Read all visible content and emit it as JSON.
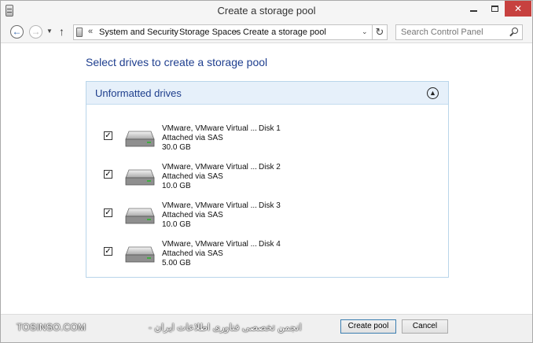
{
  "window": {
    "title": "Create a storage pool"
  },
  "title_buttons": {
    "minimize_icon": "minimize-icon",
    "maximize_icon": "maximize-icon",
    "close_label": "✕"
  },
  "nav": {
    "back_glyph": "←",
    "forward_glyph": "→",
    "up_glyph": "↑",
    "refresh_glyph": "↻",
    "breadcrumb": [
      "System and Security",
      "Storage Spaces",
      "Create a storage pool"
    ],
    "breadcrumb_prefix": "«",
    "search_placeholder": "Search Control Panel"
  },
  "main": {
    "heading": "Select drives to create a storage pool",
    "group_title": "Unformatted drives",
    "drives": [
      {
        "name": "VMware, VMware Virtual ...",
        "disk": "Disk 1",
        "attach": "Attached via SAS",
        "size": "30.0 GB",
        "checked": true
      },
      {
        "name": "VMware, VMware Virtual ...",
        "disk": "Disk 2",
        "attach": "Attached via SAS",
        "size": "10.0 GB",
        "checked": true
      },
      {
        "name": "VMware, VMware Virtual ...",
        "disk": "Disk 3",
        "attach": "Attached via SAS",
        "size": "10.0 GB",
        "checked": true
      },
      {
        "name": "VMware, VMware Virtual ...",
        "disk": "Disk 4",
        "attach": "Attached via SAS",
        "size": "5.00 GB",
        "checked": true
      }
    ]
  },
  "footer": {
    "watermark": "TOSINSO.COM",
    "watermark_fa": "انجمن تخصصی فناوری اطلاعات ایران -",
    "create_label": "Create pool",
    "cancel_label": "Cancel"
  },
  "colors": {
    "accent": "#1f3f8f",
    "close_button": "#c7413f",
    "group_header_bg": "#e6f0fa"
  }
}
